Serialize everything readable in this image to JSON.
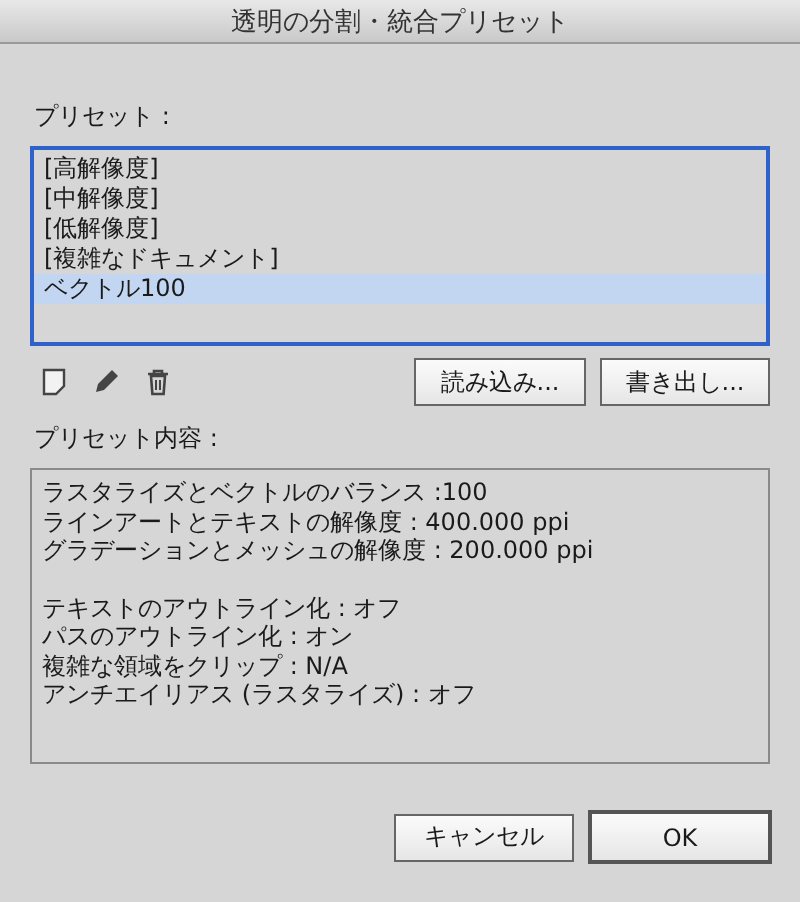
{
  "window": {
    "title": "透明の分割・統合プリセット"
  },
  "presets": {
    "label": "プリセット :",
    "items": [
      {
        "label": "[高解像度]",
        "selected": false
      },
      {
        "label": "[中解像度]",
        "selected": false
      },
      {
        "label": "[低解像度]",
        "selected": false
      },
      {
        "label": "[複雑なドキュメント]",
        "selected": false
      },
      {
        "label": "ベクトル100",
        "selected": true
      }
    ]
  },
  "toolbar": {
    "buttons": [
      "読み込み...",
      "書き出し..."
    ]
  },
  "content": {
    "label": "プリセット内容 :",
    "groups": [
      [
        "ラスタライズとベクトルのバランス :100",
        "ラインアートとテキストの解像度 : 400.000 ppi",
        "グラデーションとメッシュの解像度 : 200.000 ppi"
      ],
      [
        "テキストのアウトライン化 : オフ",
        "パスのアウトライン化 : オン",
        "複雑な領域をクリップ : N/A",
        "アンチエイリアス (ラスタライズ) : オフ"
      ]
    ]
  },
  "footer": {
    "buttons": [
      {
        "label": "キャンセル",
        "default": false
      },
      {
        "label": "OK",
        "default": true
      }
    ]
  }
}
